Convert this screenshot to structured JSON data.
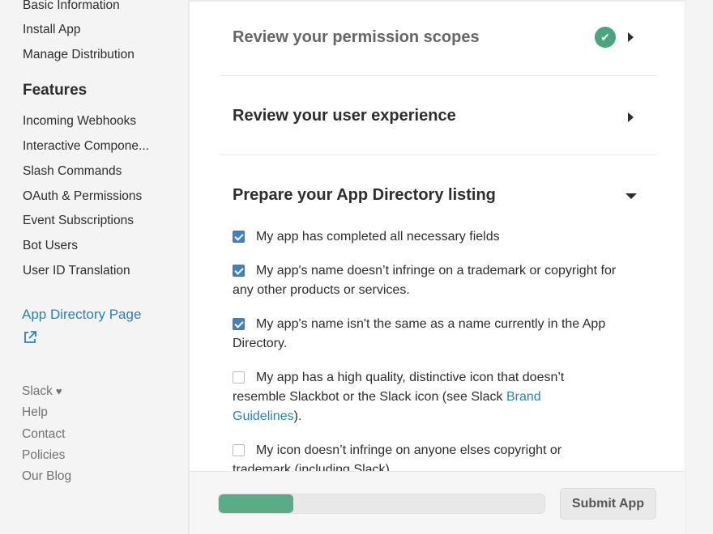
{
  "sidebar": {
    "top_items": [
      {
        "label": "Basic Information"
      },
      {
        "label": "Install App"
      },
      {
        "label": "Manage Distribution"
      }
    ],
    "features_title": "Features",
    "feature_items": [
      {
        "label": "Incoming Webhooks"
      },
      {
        "label": "Interactive Compone..."
      },
      {
        "label": "Slash Commands"
      },
      {
        "label": "OAuth & Permissions"
      },
      {
        "label": "Event Subscriptions"
      },
      {
        "label": "Bot Users"
      },
      {
        "label": "User ID Translation"
      }
    ],
    "app_directory_link": "App Directory Page",
    "footer_links": [
      {
        "label": "Slack"
      },
      {
        "label": "Help"
      },
      {
        "label": "Contact"
      },
      {
        "label": "Policies"
      },
      {
        "label": "Our Blog"
      }
    ]
  },
  "main": {
    "sections": [
      {
        "title": "Review your permission scopes",
        "state": "collapsed",
        "complete": true
      },
      {
        "title": "Review your user experience",
        "state": "collapsed",
        "complete": false
      },
      {
        "title": "Prepare your App Directory listing",
        "state": "expanded",
        "complete": false
      }
    ],
    "checklist": [
      {
        "text": "My app has completed all necessary fields",
        "checked": true
      },
      {
        "text": "My app's name doesn’t infringe on a trademark or copyright for any other products or services.",
        "checked": true
      },
      {
        "text": "My app's name isn't the same as a name currently in the App Directory.",
        "checked": true
      },
      {
        "text_before": "My app has a high quality, distinctive icon that doesn’t resemble Slackbot or the Slack icon (see Slack ",
        "link": "Brand Guidelines",
        "text_after": ").",
        "checked": false
      },
      {
        "text": "My icon doesn’t infringe on anyone elses copyright or trademark (including Slack).",
        "checked": false
      }
    ]
  },
  "footer": {
    "progress": 0.23,
    "submit_label": "Submit App"
  },
  "colors": {
    "accent_link": "#2a80b9",
    "success": "#4aa57c",
    "checkbox": "#3f81c3",
    "progress": "#5aab86"
  }
}
